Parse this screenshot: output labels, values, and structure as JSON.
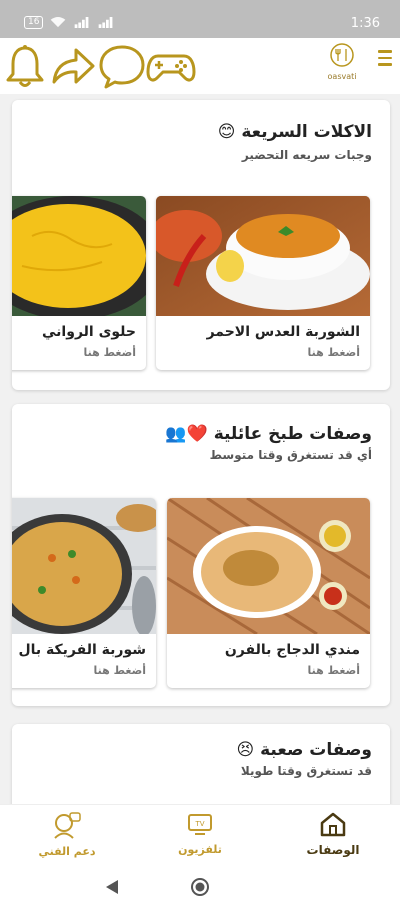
{
  "status_bar": {
    "battery": "16",
    "time": "1:36"
  },
  "toolbar": {
    "icons": [
      "bell-icon",
      "share-icon",
      "chat-icon",
      "gamepad-icon"
    ],
    "logo_text": "oasvati",
    "accent": "#b8961e"
  },
  "sections": [
    {
      "title": "الاكلات السريعة",
      "emoji": "😊",
      "subtitle": "وجبات سريعه التحضير",
      "cards": [
        {
          "title": "الشوربة العدس الاحمر",
          "cta": "أضغط هنا"
        },
        {
          "title": "حلوى الرواني",
          "cta": "أضغط هنا"
        }
      ]
    },
    {
      "title": "وصفات طبخ عائلية",
      "emoji": "❤️👥",
      "subtitle": "أي قد تستغرق وقتا متوسط",
      "cards": [
        {
          "title": "مندي الدجاج بالفرن",
          "cta": "أضغط هنا"
        },
        {
          "title": "شوربة الفريكة بال",
          "cta": "أضغط هنا"
        }
      ]
    },
    {
      "title": "وصفات صعبة",
      "emoji": "😣",
      "subtitle": "قد تستغرق وقتا طويلا"
    }
  ],
  "bottom_nav": [
    {
      "label": "الوصفات",
      "icon": "home-icon",
      "active": true
    },
    {
      "label": "تلفزيون",
      "icon": "tv-icon",
      "tv_text": "TV",
      "active": false
    },
    {
      "label": "دعم الفني",
      "icon": "support-icon",
      "active": false
    }
  ],
  "colors": {
    "gold": "#b8961e",
    "active_nav": "#4a3a12",
    "nav_inactive": "#c19a2e"
  }
}
